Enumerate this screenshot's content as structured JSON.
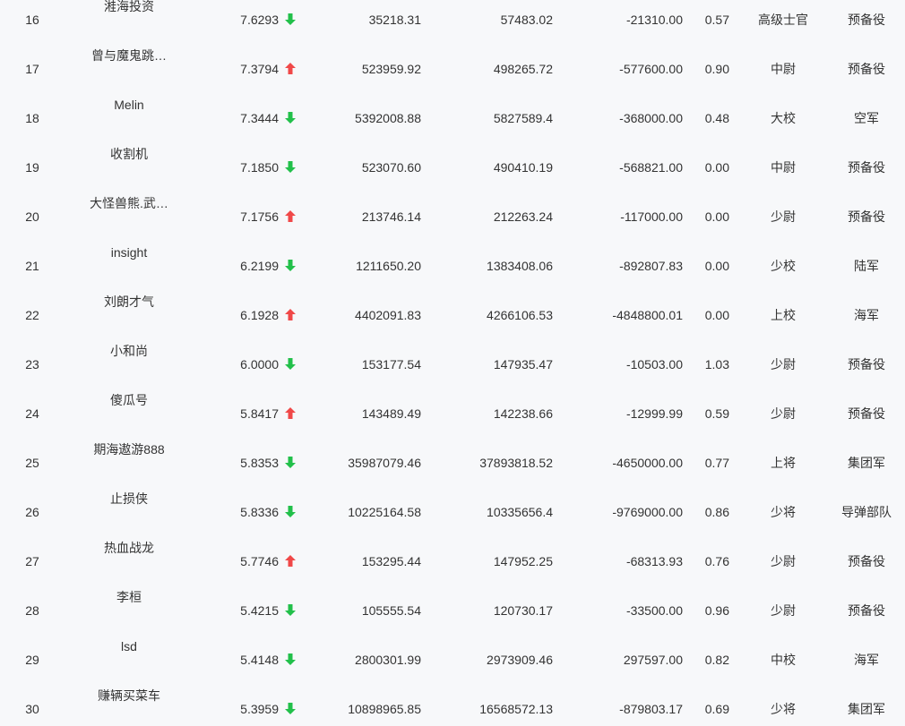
{
  "colors": {
    "up": "#f04848",
    "down": "#22c04a",
    "text": "#333333",
    "background": "#f7f8fa"
  },
  "rows": [
    {
      "rank": "16",
      "name": "溎海投资",
      "score": "7.6293",
      "trend": "down",
      "a": "35218.31",
      "b": "57483.02",
      "c": "-21310.00",
      "ratio": "0.57",
      "title": "高级士官",
      "branch": "预备役"
    },
    {
      "rank": "17",
      "name": "曾与魔鬼跳…",
      "score": "7.3794",
      "trend": "up",
      "a": "523959.92",
      "b": "498265.72",
      "c": "-577600.00",
      "ratio": "0.90",
      "title": "中尉",
      "branch": "预备役"
    },
    {
      "rank": "18",
      "name": "Melin",
      "score": "7.3444",
      "trend": "down",
      "a": "5392008.88",
      "b": "5827589.4",
      "c": "-368000.00",
      "ratio": "0.48",
      "title": "大校",
      "branch": "空军"
    },
    {
      "rank": "19",
      "name": "收割机",
      "score": "7.1850",
      "trend": "down",
      "a": "523070.60",
      "b": "490410.19",
      "c": "-568821.00",
      "ratio": "0.00",
      "title": "中尉",
      "branch": "预备役"
    },
    {
      "rank": "20",
      "name": "大怪兽熊.武…",
      "score": "7.1756",
      "trend": "up",
      "a": "213746.14",
      "b": "212263.24",
      "c": "-117000.00",
      "ratio": "0.00",
      "title": "少尉",
      "branch": "预备役"
    },
    {
      "rank": "21",
      "name": "insight",
      "score": "6.2199",
      "trend": "down",
      "a": "1211650.20",
      "b": "1383408.06",
      "c": "-892807.83",
      "ratio": "0.00",
      "title": "少校",
      "branch": "陆军"
    },
    {
      "rank": "22",
      "name": "刘朗才气",
      "score": "6.1928",
      "trend": "up",
      "a": "4402091.83",
      "b": "4266106.53",
      "c": "-4848800.01",
      "ratio": "0.00",
      "title": "上校",
      "branch": "海军"
    },
    {
      "rank": "23",
      "name": "小和尚",
      "score": "6.0000",
      "trend": "down",
      "a": "153177.54",
      "b": "147935.47",
      "c": "-10503.00",
      "ratio": "1.03",
      "title": "少尉",
      "branch": "预备役"
    },
    {
      "rank": "24",
      "name": "傻瓜号",
      "score": "5.8417",
      "trend": "up",
      "a": "143489.49",
      "b": "142238.66",
      "c": "-12999.99",
      "ratio": "0.59",
      "title": "少尉",
      "branch": "预备役"
    },
    {
      "rank": "25",
      "name": "期海遨游888",
      "score": "5.8353",
      "trend": "down",
      "a": "35987079.46",
      "b": "37893818.52",
      "c": "-4650000.00",
      "ratio": "0.77",
      "title": "上将",
      "branch": "集团军"
    },
    {
      "rank": "26",
      "name": "止损侠",
      "score": "5.8336",
      "trend": "down",
      "a": "10225164.58",
      "b": "10335656.4",
      "c": "-9769000.00",
      "ratio": "0.86",
      "title": "少将",
      "branch": "导弹部队"
    },
    {
      "rank": "27",
      "name": "热血战龙",
      "score": "5.7746",
      "trend": "up",
      "a": "153295.44",
      "b": "147952.25",
      "c": "-68313.93",
      "ratio": "0.76",
      "title": "少尉",
      "branch": "预备役"
    },
    {
      "rank": "28",
      "name": "李桓",
      "score": "5.4215",
      "trend": "down",
      "a": "105555.54",
      "b": "120730.17",
      "c": "-33500.00",
      "ratio": "0.96",
      "title": "少尉",
      "branch": "预备役"
    },
    {
      "rank": "29",
      "name": "lsd",
      "score": "5.4148",
      "trend": "down",
      "a": "2800301.99",
      "b": "2973909.46",
      "c": "297597.00",
      "ratio": "0.82",
      "title": "中校",
      "branch": "海军"
    },
    {
      "rank": "30",
      "name": "赚辆买菜车",
      "score": "5.3959",
      "trend": "down",
      "a": "10898965.85",
      "b": "16568572.13",
      "c": "-879803.17",
      "ratio": "0.69",
      "title": "少将",
      "branch": "集团军"
    }
  ]
}
